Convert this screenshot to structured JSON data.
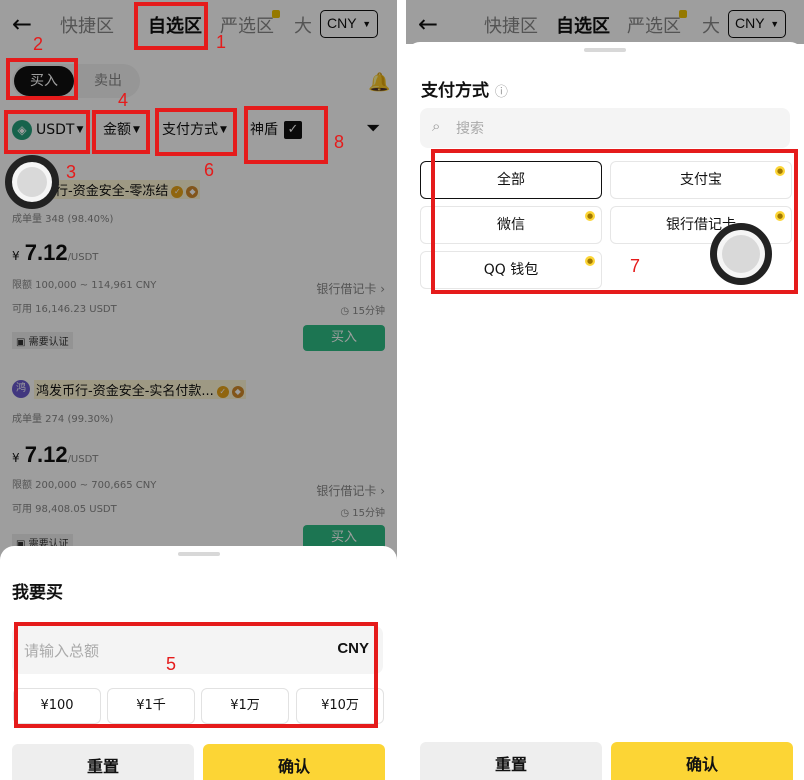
{
  "left": {
    "header": {
      "back_icon": "←",
      "tabs": [
        "快捷区",
        "自选区",
        "严选区",
        "大"
      ],
      "currency": "CNY",
      "currency_caret": "▼"
    },
    "side": {
      "buy": "买入",
      "sell": "卖出"
    },
    "filters": {
      "asset": "USDT",
      "amount": "金额",
      "payment": "支付方式",
      "shield": "神盾",
      "caret": "▼",
      "check": "✓"
    },
    "listings": [
      {
        "name": "币行-资金安全-零冻结",
        "stats": "成单量 348 (98.40%)",
        "currency_symbol": "¥",
        "price": "7.12",
        "unit": "/USDT",
        "limit": "限额 100,000 ~ 114,961 CNY",
        "available": "可用 16,146.23 USDT",
        "payment": "银行借记卡 ›",
        "time": "◷ 15分钟",
        "verify": "▣ 需要认证",
        "buy": "买入"
      },
      {
        "name": "鸿发币行-资金安全-实名付款...",
        "stats": "成单量 274 (99.30%)",
        "currency_symbol": "¥",
        "price": "7.12",
        "unit": "/USDT",
        "limit": "限额 200,000 ~ 700,665 CNY",
        "available": "可用 98,408.05 USDT",
        "payment": "银行借记卡 ›",
        "time": "◷ 15分钟",
        "verify": "▣ 需要认证",
        "buy": "买入"
      }
    ],
    "sheet": {
      "title": "我要买",
      "placeholder": "请输入总额",
      "unit": "CNY",
      "quick": [
        "¥100",
        "¥1千",
        "¥1万",
        "¥10万"
      ],
      "reset": "重置",
      "confirm": "确认"
    },
    "annotations": [
      "1",
      "2",
      "3",
      "4",
      "5",
      "6",
      "8"
    ]
  },
  "right": {
    "header": {
      "back_icon": "←",
      "tabs": [
        "快捷区",
        "自选区",
        "严选区",
        "大"
      ],
      "currency": "CNY",
      "currency_caret": "▼"
    },
    "sheet": {
      "title": "支付方式",
      "info_icon": "ⓘ",
      "search_icon": "⌕",
      "search_placeholder": "搜索",
      "options": [
        "全部",
        "支付宝",
        "微信",
        "银行借记卡",
        "QQ 钱包"
      ],
      "reset": "重置",
      "confirm": "确认"
    },
    "annotations": [
      "7"
    ]
  },
  "colors": {
    "accent": "#fcd535",
    "buy_green": "#2ebd85",
    "annotation_red": "#e51b1b"
  }
}
